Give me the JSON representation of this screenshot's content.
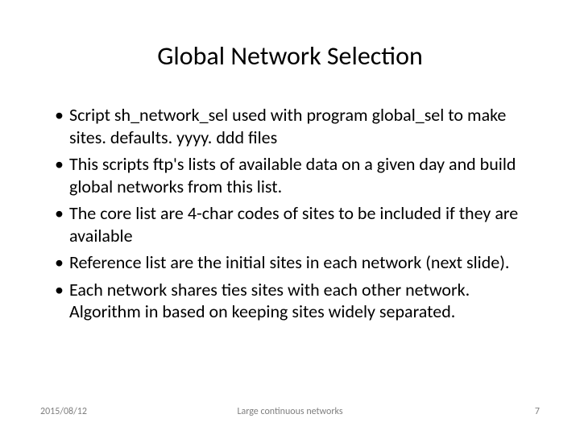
{
  "title": "Global Network Selection",
  "bullets": [
    "Script sh_network_sel used with program global_sel to make sites. defaults. yyyy. ddd files",
    "This scripts ftp's lists of available data on a given day and build global networks from this list.",
    "The core list are 4-char codes of sites to be included if they are available",
    "Reference list are the initial sites in each network (next slide).",
    "Each network shares ties sites with each other network. Algorithm in based on keeping sites widely separated."
  ],
  "footer": {
    "date": "2015/08/12",
    "center": "Large continuous networks",
    "page": "7"
  }
}
